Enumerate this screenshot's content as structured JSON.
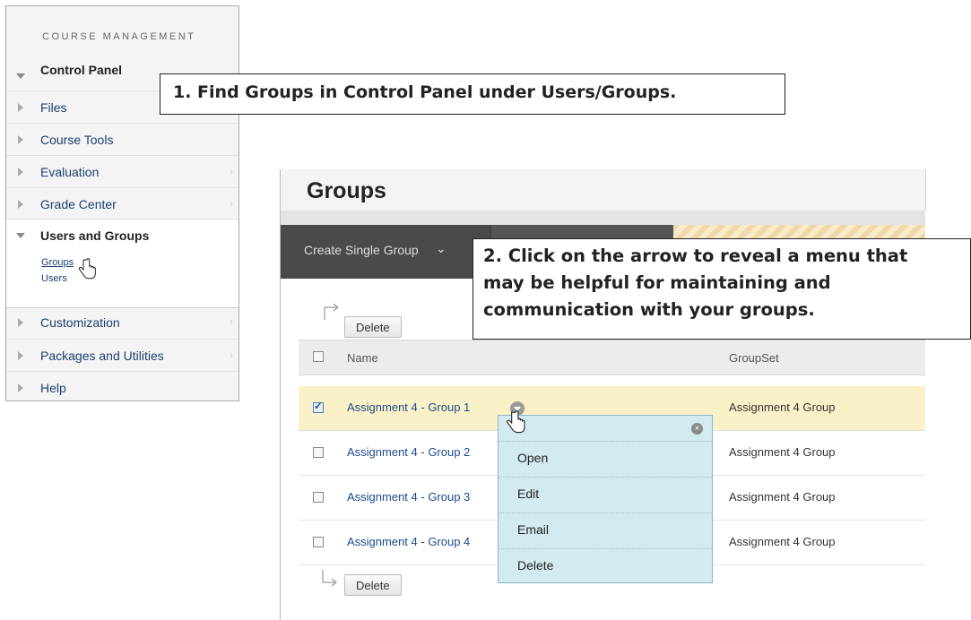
{
  "sidebar": {
    "heading": "COURSE MANAGEMENT",
    "control_panel": "Control Panel",
    "items": [
      {
        "label": "Files"
      },
      {
        "label": "Course Tools"
      },
      {
        "label": "Evaluation"
      },
      {
        "label": "Grade Center"
      }
    ],
    "users_and_groups": {
      "label": "Users and Groups",
      "sub_items": [
        "Groups",
        "Users"
      ]
    },
    "bottom_items": [
      {
        "label": "Customization"
      },
      {
        "label": "Packages and Utilities"
      },
      {
        "label": "Help"
      }
    ]
  },
  "callouts": {
    "step1": "1. Find Groups in Control Panel under Users/Groups.",
    "step2_line1": "2. Click on the arrow to reveal a menu that",
    "step2_line2": "may be helpful for maintaining and",
    "step2_line3": "communication with your groups."
  },
  "groups_page": {
    "title": "Groups",
    "toolbar_button": "Create Single Group",
    "delete_label": "Delete",
    "columns": {
      "name": "Name",
      "groupset": "GroupSet"
    },
    "rows": [
      {
        "name": "Assignment 4 - Group 1",
        "groupset": "Assignment 4 Group",
        "checked": true
      },
      {
        "name": "Assignment 4 - Group 2",
        "groupset": "Assignment 4 Group",
        "checked": false
      },
      {
        "name": "Assignment 4 - Group 3",
        "groupset": "Assignment 4 Group",
        "checked": false
      },
      {
        "name": "Assignment 4 - Group 4",
        "groupset": "Assignment 4 Group",
        "checked": false
      }
    ]
  },
  "context_menu": {
    "items": [
      "Open",
      "Edit",
      "Email",
      "Delete"
    ]
  },
  "colors": {
    "link": "#1c4b8a",
    "selected_row": "#fbf1c8",
    "menu_bg": "#d3ebf0",
    "toolbar": "#555555"
  }
}
